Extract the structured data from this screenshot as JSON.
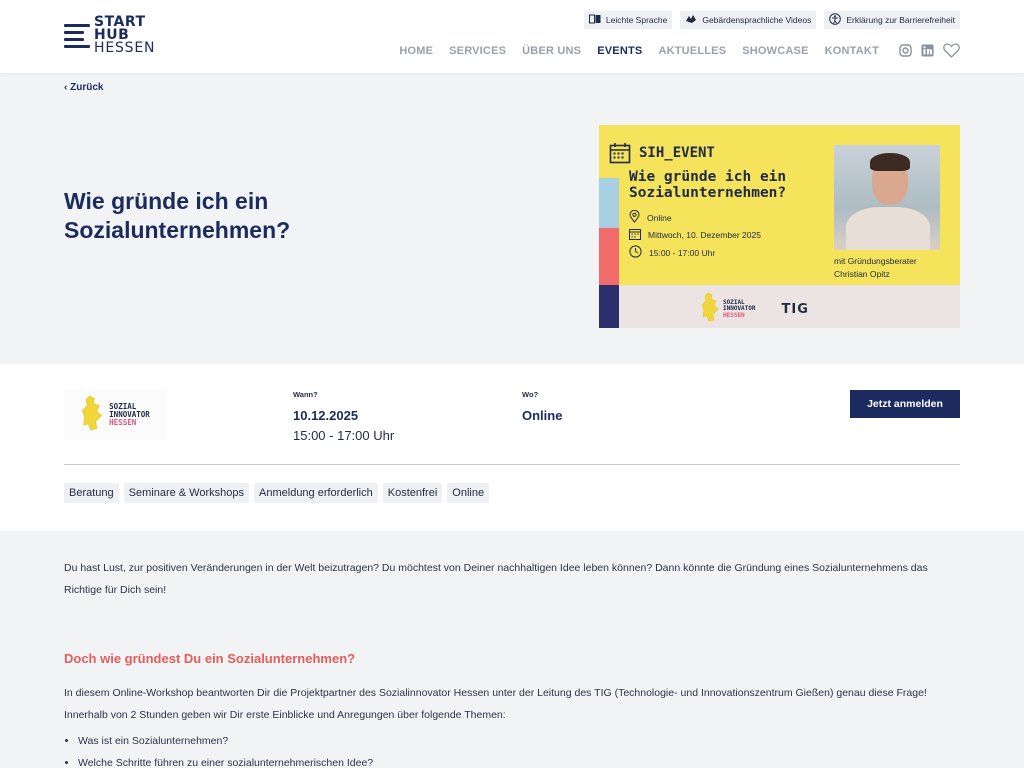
{
  "header": {
    "logo": {
      "line1": "START",
      "line2": "HUB",
      "line3": "HESSEN"
    },
    "access": [
      {
        "icon": "book-icon",
        "label": "Leichte Sprache"
      },
      {
        "icon": "sign-language-icon",
        "label": "Gebärdensprachliche Videos"
      },
      {
        "icon": "accessibility-icon",
        "label": "Erklärung zur Barrierefreiheit"
      }
    ],
    "nav": [
      "HOME",
      "SERVICES",
      "ÜBER UNS",
      "EVENTS",
      "AKTUELLES",
      "SHOWCASE",
      "KONTAKT"
    ],
    "active_nav": "EVENTS"
  },
  "hero": {
    "back": "Zurück",
    "title": "Wie gründe ich ein Sozialunternehmen?",
    "image": {
      "tag": "SIH_EVENT",
      "title": "Wie gründe ich ein Sozialunternehmen?",
      "location": "Online",
      "date": "Mittwoch, 10. Dezember 2025",
      "time": "15:00 - 17:00 Uhr",
      "credit_line1": "mit Gründungsberater",
      "credit_line2": "Christian Opitz",
      "partner_logo": {
        "line1": "SOZIAL",
        "line2": "INNOVATOR",
        "line3": "HESSEN"
      },
      "partner2": "TIG"
    }
  },
  "info": {
    "org_logo": {
      "line1": "SOZIAL",
      "line2": "INNOVATOR",
      "line3": "HESSEN"
    },
    "when_label": "Wann?",
    "date": "10.12.2025",
    "time": "15:00 - 17:00 Uhr",
    "where_label": "Wo?",
    "where": "Online",
    "cta": "Jetzt anmelden",
    "tags": [
      "Beratung",
      "Seminare & Workshops",
      "Anmeldung erforderlich",
      "Kostenfrei",
      "Online"
    ]
  },
  "content": {
    "intro": "Du hast Lust, zur positiven Veränderungen in der Welt beizutragen? Du möchtest von Deiner nachhaltigen Idee leben können? Dann könnte die Gründung eines Sozialunternehmens das Richtige für Dich sein!",
    "subhead": "Doch wie gründest Du ein Sozialunternehmen?",
    "para": "In diesem Online-Workshop beantworten Dir die Projektpartner des Sozialinnovator Hessen unter der Leitung des TIG (Technologie- und Innovationszentrum Gießen) genau diese Frage! Innerhalb von 2 Stunden geben wir Dir erste Einblicke und Anregungen über folgende Themen:",
    "bullets": [
      "Was ist ein Sozialunternehmen?",
      "Welche Schritte führen zu einer sozialunternehmerischen Idee?"
    ]
  },
  "colors": {
    "navy": "#1b2b5e",
    "accent_red": "#e45c5c",
    "event_yellow": "#f5e35b"
  }
}
